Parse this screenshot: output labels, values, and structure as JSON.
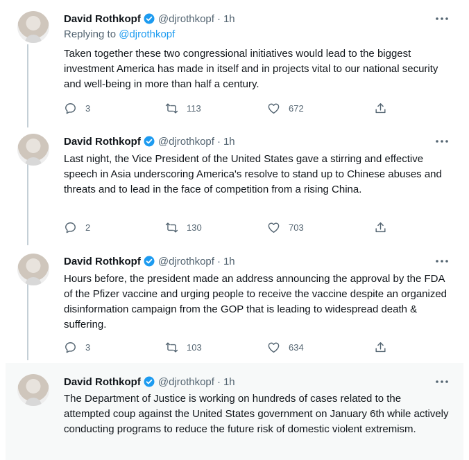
{
  "tweets": [
    {
      "author": "David Rothkopf",
      "handle": "@djrothkopf",
      "time": "1h",
      "replying_label": "Replying to",
      "replying_handle": "@djrothkopf",
      "text": "Taken together these two congressional initiatives would lead to the biggest investment America has made in itself and in projects vital to our national security and well-being in more than half a century.",
      "replies": "3",
      "retweets": "113",
      "likes": "672"
    },
    {
      "author": "David Rothkopf",
      "handle": "@djrothkopf",
      "time": "1h",
      "text": "Last night, the Vice President of the United States gave a stirring and effective speech in Asia underscoring America's resolve to stand up to Chinese abuses and threats and to lead in the face of competition from a rising China.",
      "replies": "2",
      "retweets": "130",
      "likes": "703"
    },
    {
      "author": "David Rothkopf",
      "handle": "@djrothkopf",
      "time": "1h",
      "text": "Hours before, the president made an address announcing the approval by the FDA of the Pfizer vaccine and urging people to receive the vaccine despite an organized disinformation campaign from the GOP that is leading to widespread death & suffering.",
      "replies": "3",
      "retweets": "103",
      "likes": "634"
    },
    {
      "author": "David Rothkopf",
      "handle": "@djrothkopf",
      "time": "1h",
      "text": "The Department of Justice is working on hundreds of cases related to the attempted coup against the United States government on January 6th while actively conducting programs to reduce the future risk of domestic violent extremism."
    }
  ],
  "separator": "·",
  "icons": {
    "verified": "verified-badge-icon",
    "more": "more-options-icon",
    "reply": "reply-icon",
    "retweet": "retweet-icon",
    "like": "heart-icon",
    "share": "share-icon"
  },
  "colors": {
    "accent": "#1d9bf0",
    "secondary_text": "#536471",
    "thread_line": "#c4cfd6",
    "highlight_bg": "#f7f9f9"
  }
}
